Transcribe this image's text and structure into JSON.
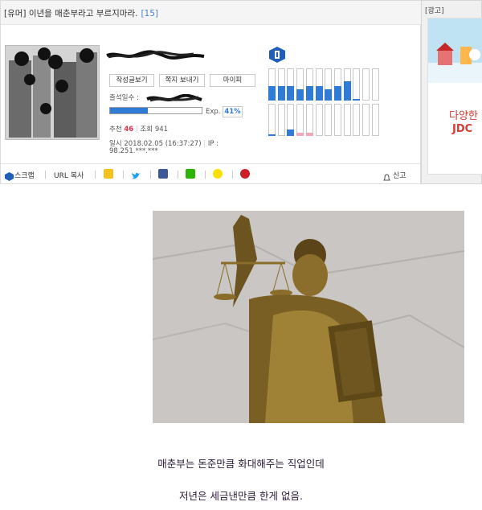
{
  "post": {
    "title": "[유머] 이년을 매춘부라고 부르지마라.",
    "comment_count": "[15]",
    "profile_buttons": [
      "작성글보기",
      "쪽지 보내기",
      "마이피"
    ],
    "attendance_label": "출석일수 :",
    "exp_label": "Exp.",
    "exp_percent": "41%",
    "exp_fraction": 0.41,
    "recommend_label": "추천",
    "recommend_count": "46",
    "view_label": "조회",
    "view_count": "941",
    "date_line": "일시 2018.02.05 (16:37:27)",
    "ip_label": "IP :",
    "ip_value": "98.251.***.***"
  },
  "toolbar": {
    "scrap": "스크랩",
    "url_copy": "URL 복사",
    "report": "신고",
    "share_icons": [
      "kakaostory-icon",
      "twitter-icon",
      "facebook-icon",
      "naver-icon",
      "kakaotalk-icon",
      "pinterest-icon"
    ]
  },
  "ad": {
    "label": "[광고]",
    "line1": "다양한",
    "line2": "JDC"
  },
  "content": {
    "line1": "매춘부는 돈준만큼 화대해주는 직업인데",
    "line2": "저년은 세금낸만큼 한게 없음."
  },
  "colors": {
    "accent_blue": "#2f7bd6",
    "pink": "#f2a6b8",
    "red": "#e0314b"
  },
  "activity_bars": {
    "top_levels": [
      0.45,
      0.45,
      0.45,
      0.35,
      0.45,
      0.45,
      0.35,
      0.45,
      0.6,
      0.05,
      0,
      0
    ],
    "bottom_levels": [
      0.05,
      0,
      0.2,
      0.1,
      0.1,
      0,
      0,
      0,
      0,
      0,
      0,
      0
    ]
  }
}
